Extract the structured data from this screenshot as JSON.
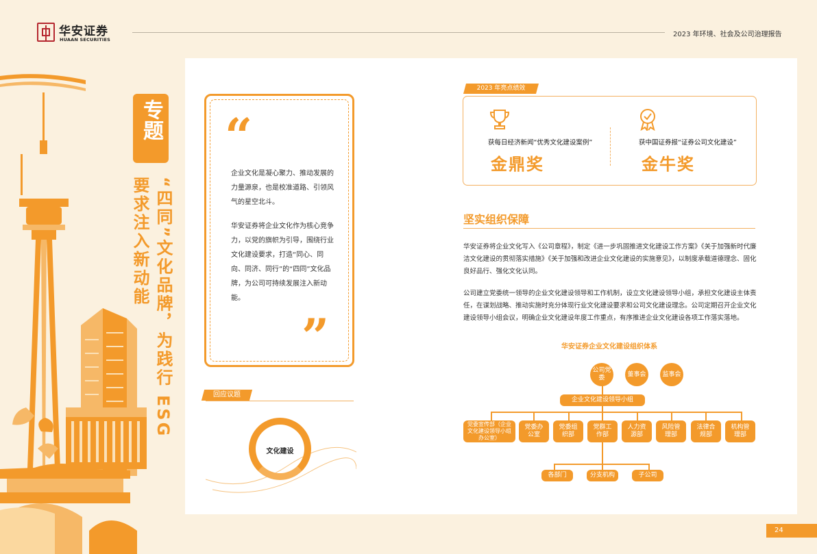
{
  "header": {
    "brand_cn": "华安证券",
    "brand_en": "HUAAN SECURITIES",
    "report_title": "2023 年环境、社会及公司治理报告"
  },
  "topic": {
    "badge": "专题",
    "title_line1": "“四同”文化品牌，为践行 ESG",
    "title_line2": "要求注入新动能"
  },
  "quote": {
    "open": "“",
    "close": "”",
    "p1": "企业文化是凝心聚力、推动发展的力量源泉，也是校准道路、引领风气的星空北斗。",
    "p2": "华安证券将企业文化作为核心竞争力，以党的旗帜为引导，围绕行业文化建设要求，打造“同心、同向、同济、同行”的“四同”文化品牌，为公司可持续发展注入新动能。"
  },
  "response": {
    "tag": "回应议题",
    "topic": "文化建设"
  },
  "highlights": {
    "tag": "2023 年亮点绩效",
    "items": [
      {
        "caption": "获每日经济新闻“优秀文化建设案例”",
        "award": "金鼎奖",
        "icon": "trophy-icon"
      },
      {
        "caption": "获中国证券报“证券公司文化建设”",
        "award": "金牛奖",
        "icon": "medal-icon"
      }
    ]
  },
  "section": {
    "title": "坚实组织保障",
    "p1": "华安证券将企业文化写入《公司章程》，制定《进一步巩固推进文化建设工作方案》《关于加强新时代廉洁文化建设的贯彻落实措施》《关于加强和改进企业文化建设的实施意见》，以制度承载道德理念、固化良好品行、强化文化认同。",
    "p2": "公司建立党委统一领导的企业文化建设领导和工作机制，设立文化建设领导小组，承担文化建设主体责任，在谋划战略、推动实施时充分体现行业文化建设要求和公司文化建设理念。公司定期召开企业文化建设领导小组会议，明确企业文化建设年度工作重点，有序推进企业文化建设各项工作落实落地。"
  },
  "org": {
    "title": "华安证券企业文化建设组织体系",
    "top": [
      "公司党委",
      "董事会",
      "监事会"
    ],
    "group": "企业文化建设领导小组",
    "depts": [
      "党委宣传部（企业文化建设领导小组办公室）",
      "党委办公室",
      "党委组织部",
      "党群工作部",
      "人力资源部",
      "风险管理部",
      "法律合规部",
      "机构管理部"
    ],
    "bottom": [
      "各部门",
      "分支机构",
      "子公司"
    ]
  },
  "page": {
    "number": "24"
  },
  "colors": {
    "accent": "#f39a2b",
    "background": "#fbf1df",
    "brand_red": "#b5262e"
  }
}
